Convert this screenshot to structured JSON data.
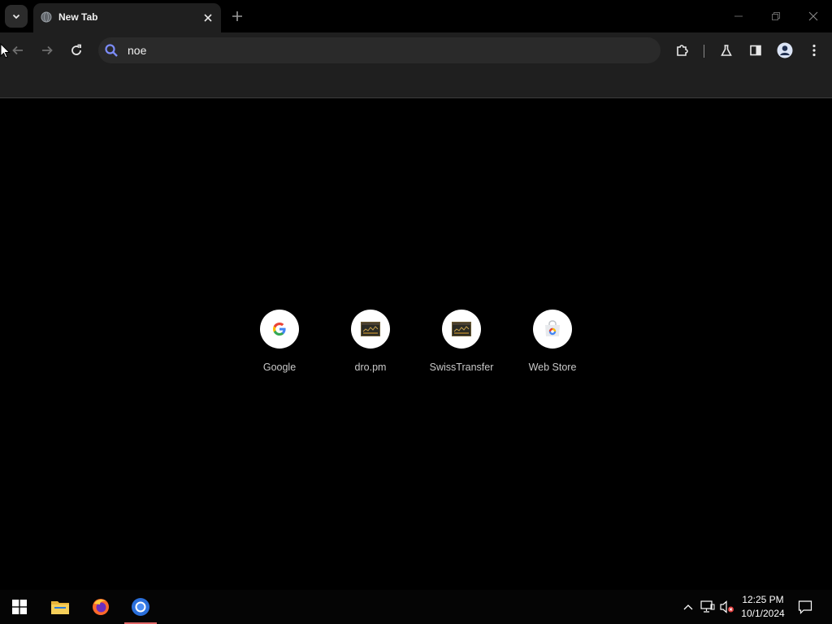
{
  "browser": {
    "tab": {
      "title": "New Tab"
    },
    "omnibox": {
      "value": "noe"
    }
  },
  "shortcuts": [
    {
      "label": "Google",
      "icon": "google-g-icon"
    },
    {
      "label": "dro.pm",
      "icon": "site-thumbnail-icon"
    },
    {
      "label": "SwissTransfer",
      "icon": "site-thumbnail-icon"
    },
    {
      "label": "Web Store",
      "icon": "web-store-icon"
    }
  ],
  "taskbar": {
    "apps": [
      "start-icon",
      "file-explorer-icon",
      "firefox-icon",
      "chrome-icon"
    ],
    "clock": {
      "time": "12:25 PM",
      "date": "10/1/2024"
    }
  },
  "colors": {
    "page_bg": "#000000",
    "toolbar_bg": "#1f1f1f",
    "omnibox_bg": "#2a2a2a",
    "search_icon": "#7c8cf8"
  }
}
